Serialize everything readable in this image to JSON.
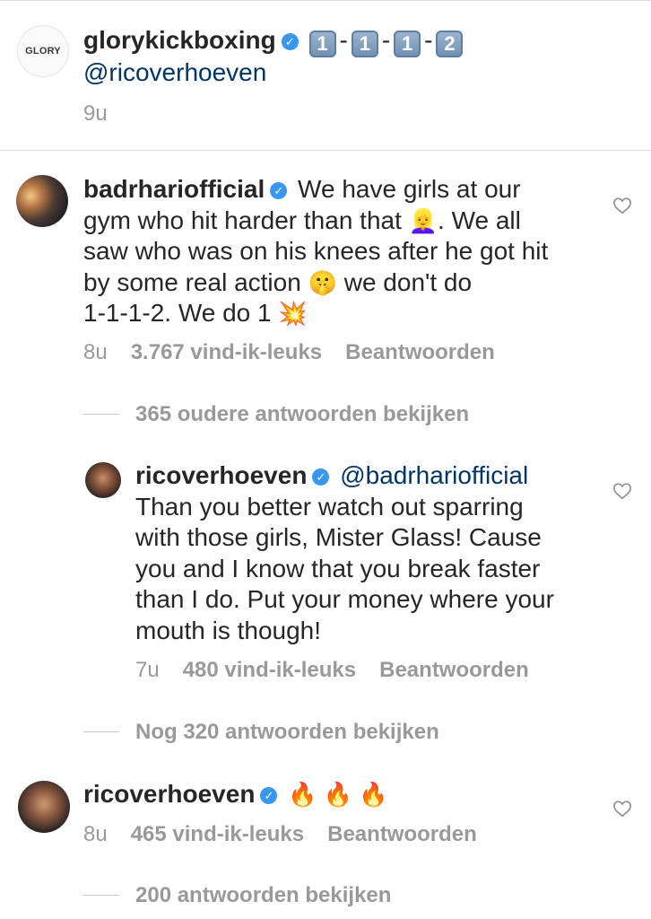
{
  "caption": {
    "username": "glorykickboxing",
    "keycaps": [
      "1",
      "1",
      "1",
      "2"
    ],
    "mention": "@ricoverhoeven",
    "time": "9u",
    "avatar_text": "GLORY"
  },
  "comments": [
    {
      "username": "badrhariofficial",
      "lines": [
        "We have girls at our",
        "gym who hit harder than that",
        ". We all",
        "saw who was on his knees after he got hit",
        "by some real action",
        "we don't do",
        "1-1-1-2. We do 1"
      ],
      "time": "8u",
      "likes": "3.767 vind-ik-leuks",
      "reply": "Beantwoorden",
      "view_replies": "365 oudere antwoorden bekijken"
    },
    {
      "username": "ricoverhoeven",
      "mention": "@badrhariofficial",
      "lines": [
        "Than you better watch out sparring",
        "with those girls, Mister Glass! Cause",
        "you and I know that you break faster",
        "than I do. Put your money where your",
        "mouth is though!"
      ],
      "time": "7u",
      "likes": "480 vind-ik-leuks",
      "reply": "Beantwoorden",
      "view_replies": "Nog 320 antwoorden bekijken"
    },
    {
      "username": "ricoverhoeven",
      "emojis": "🔥 🔥 🔥",
      "time": "8u",
      "likes": "465 vind-ik-leuks",
      "reply": "Beantwoorden",
      "view_replies": "200 antwoorden bekijken"
    }
  ],
  "colors": {
    "text": "#262626",
    "muted": "#999999",
    "mention": "#003569",
    "verified": "#3897f0",
    "divider": "#dbdbdb"
  },
  "icons": [
    "verified-badge-icon",
    "heart-outline-icon"
  ]
}
